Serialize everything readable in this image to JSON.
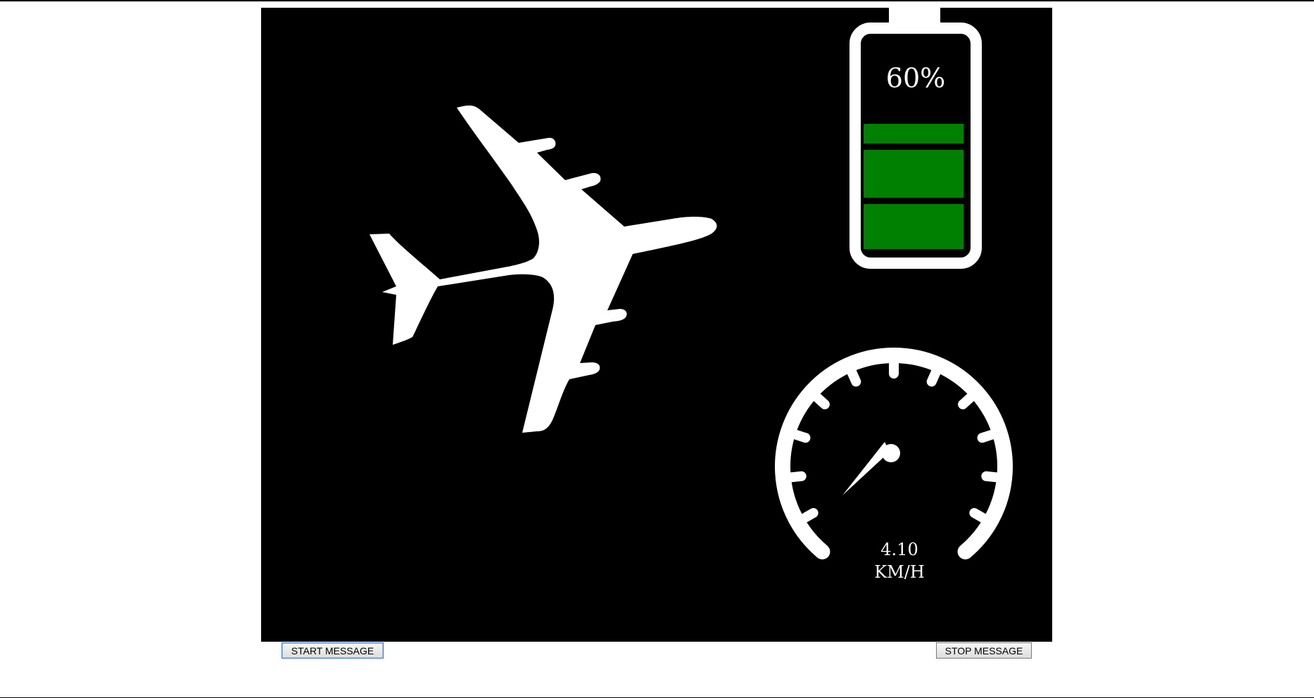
{
  "battery": {
    "percent_label": "60%",
    "level": 0.6,
    "fill_color": "#008000"
  },
  "speedometer": {
    "speed_value": "4.10",
    "unit": "KM/H"
  },
  "icons": {
    "vehicle": "airplane-icon"
  },
  "buttons": {
    "start_label": "START MESSAGE",
    "stop_label": "STOP MESSAGE"
  }
}
